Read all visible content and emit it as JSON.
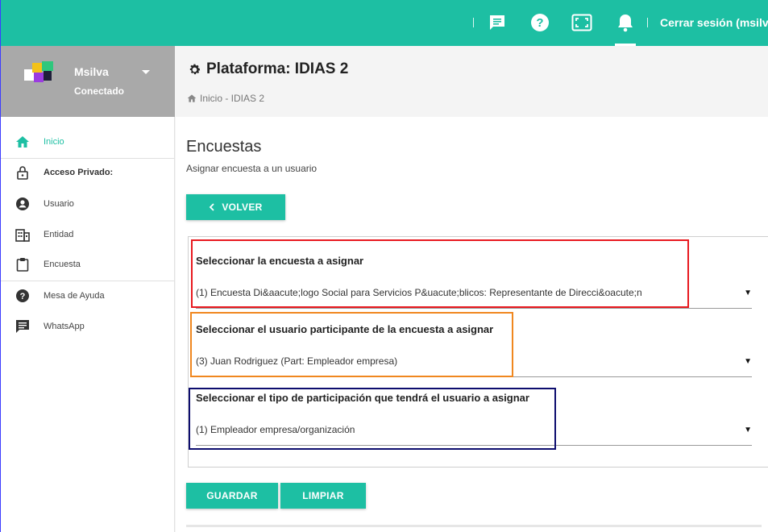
{
  "topbar": {
    "logout_label": "Cerrar sesión (msilva)",
    "icons": [
      "chat-icon",
      "help-icon",
      "fullscreen-icon",
      "bell-icon"
    ],
    "accent": "#1dbfa3"
  },
  "user": {
    "name": "Msilva",
    "status": "Conectado"
  },
  "sidebar": {
    "items": [
      {
        "label": "Inicio",
        "icon": "home-icon",
        "active": true
      },
      {
        "label": "Acceso Privado:",
        "icon": "lock-icon"
      },
      {
        "label": "Usuario",
        "icon": "user-icon"
      },
      {
        "label": "Entidad",
        "icon": "building-icon"
      },
      {
        "label": "Encuesta",
        "icon": "clipboard-icon"
      },
      {
        "label": "Mesa de Ayuda",
        "icon": "help-icon"
      },
      {
        "label": "WhatsApp",
        "icon": "chat-icon"
      }
    ]
  },
  "page": {
    "title": "Plataforma: IDIAS 2",
    "breadcrumb": "Inicio - IDIAS 2"
  },
  "section": {
    "title": "Encuestas",
    "subtitle": "Asignar encuesta a un usuario",
    "back_label": "VOLVER"
  },
  "form": {
    "fields": [
      {
        "label": "Seleccionar la encuesta a asignar",
        "value": "(1) Encuesta Di&aacute;logo Social para Servicios P&uacute;blicos: Representante de Direcci&oacute;n",
        "highlight": "#e8191f"
      },
      {
        "label": "Seleccionar el usuario participante de la encuesta a asignar",
        "value": "(3) Juan Rodriguez (Part: Empleador empresa)",
        "highlight": "#f0871f"
      },
      {
        "label": "Seleccionar el tipo de participación que tendrá el usuario a asignar",
        "value": "(1) Empleador empresa/organización",
        "highlight": "#0d0d6e"
      }
    ],
    "dropdown_arrow": "▼",
    "save_label": "GUARDAR",
    "clear_label": "LIMPIAR"
  }
}
